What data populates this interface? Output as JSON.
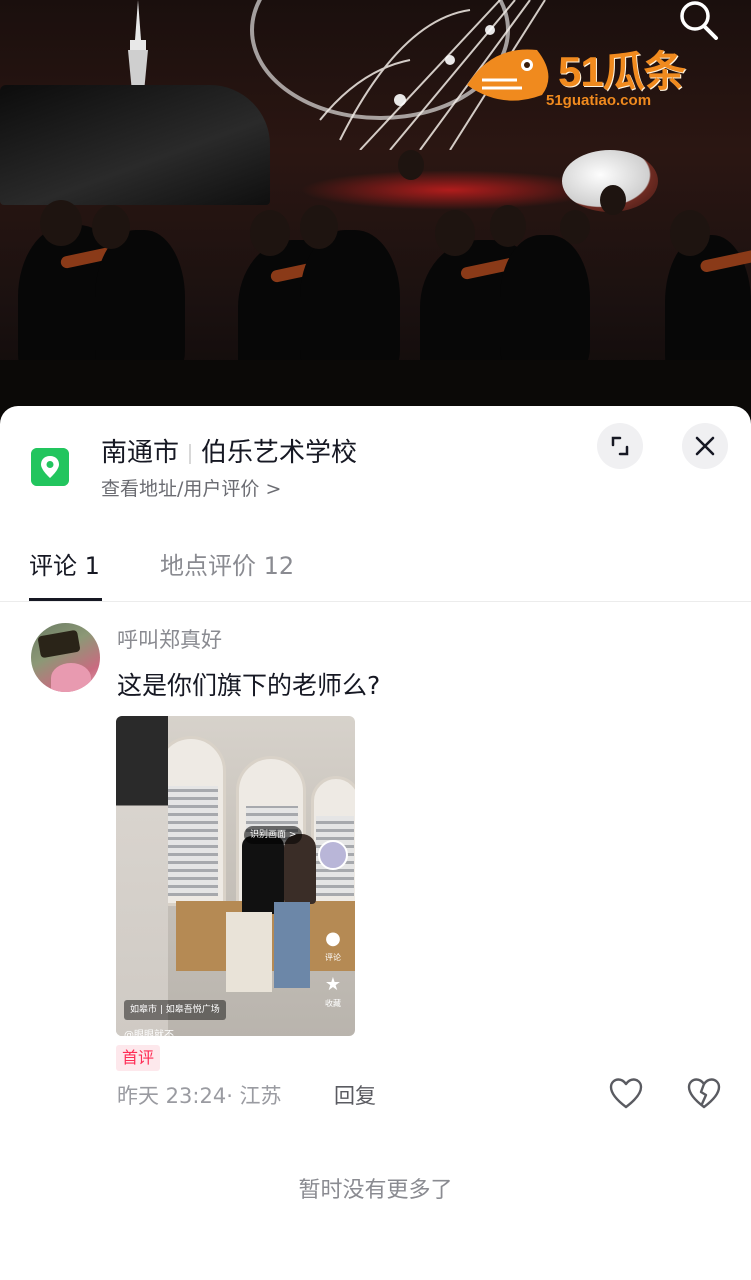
{
  "video": {
    "logo_main": "51瓜条",
    "logo_sub": "51guatiao.com"
  },
  "location": {
    "city": "南通市",
    "place": "伯乐艺术学校",
    "subtitle": "查看地址/用户评价 >"
  },
  "tabs": [
    {
      "label": "评论 1",
      "active": true
    },
    {
      "label": "地点评价 12",
      "active": false
    }
  ],
  "comment": {
    "username": "呼叫郑真好",
    "text": "这是你们旗下的老师么?",
    "badge": "首评",
    "meta": "昨天 23:24· 江苏",
    "reply_label": "回复",
    "image": {
      "recognize_label": "识别画面 >",
      "comment_label": "评论",
      "favorite_label": "收藏",
      "location": "如皋市 | 如皋吾悦广场",
      "author": "@眼眼就不"
    }
  },
  "footer": {
    "end_text": "暂时没有更多了"
  },
  "colors": {
    "accent": "#fe2c55",
    "location_icon": "#22c55e",
    "logo": "#f08a1e"
  },
  "icons": [
    "search-icon",
    "location-pin-icon",
    "expand-icon",
    "close-icon",
    "heart-icon",
    "broken-heart-icon"
  ]
}
